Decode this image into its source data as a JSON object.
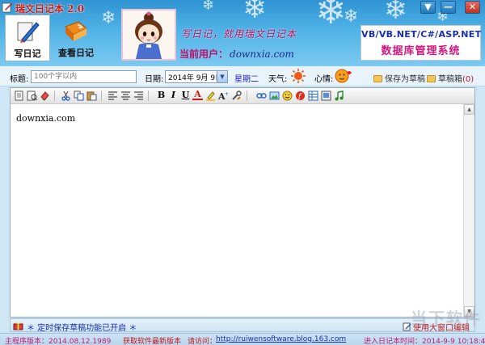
{
  "window": {
    "title": "瑞文日记本 2.0",
    "controls": {
      "down": "▼",
      "minimize": "—",
      "close": "✕"
    }
  },
  "nav": {
    "write_label": "写日记",
    "view_label": "查看日记"
  },
  "header": {
    "slogan": "写日记，就用瑞文日记本",
    "user_label": "当前用户：",
    "user_name": "downxia.com",
    "ad_line1": "VB/VB.NET/C#/ASP.NET",
    "ad_line2": "数据库管理系统"
  },
  "form": {
    "title_label": "标题:",
    "title_placeholder": "100个字以内",
    "date_label": "日期:",
    "date_value": "2014年 9月 9日",
    "weekday": "星期二",
    "weather_label": "天气:",
    "mood_label": "心情:",
    "save_draft": "保存为草稿",
    "draft_box": "草稿箱",
    "draft_count": "(0)"
  },
  "toolbar": {
    "icons": [
      "new-doc-icon",
      "open-doc-icon",
      "eraser-icon",
      "cut-icon",
      "copy-icon",
      "paste-icon",
      "align-left-icon",
      "align-center-icon",
      "align-right-icon",
      "bold-icon",
      "italic-icon",
      "underline-icon",
      "font-color-icon",
      "highlight-icon",
      "font-size-icon",
      "tools-icon",
      "link-icon",
      "image-icon",
      "smiley-icon",
      "flash-icon",
      "table-icon",
      "media-icon",
      "music-icon"
    ],
    "bold": "B",
    "italic": "I",
    "underline": "U",
    "font_color": "A"
  },
  "editor": {
    "content": "downxia.com"
  },
  "status": {
    "autosave": "＊ 定时保存草稿功能已开启 ＊",
    "big_window": "使用大窗口编辑"
  },
  "footer": {
    "version": "主程序版本：2014.08.12.1989",
    "get_software": "获取软件最新版本",
    "visit_label": "请访问：",
    "url": "http://ruiwensoftware.blog.163.com",
    "login_time": "进入日记本时间：2014-9-9 10:18:45"
  },
  "colors": {
    "header_blue": "#2f93d3",
    "title_red": "#c01818",
    "pink": "#c01a74",
    "link_blue": "#1a2fb0"
  },
  "watermark": "当下软件园"
}
